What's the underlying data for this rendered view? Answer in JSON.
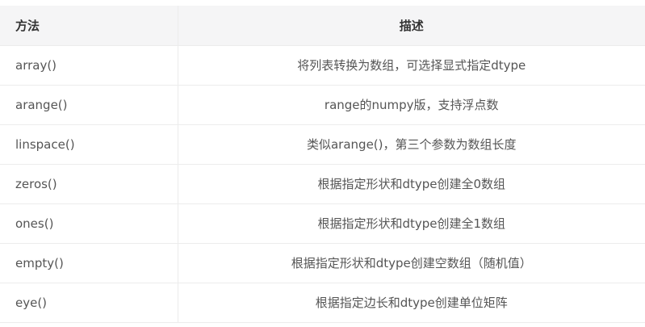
{
  "table": {
    "headers": [
      "方法",
      "描述"
    ],
    "rows": [
      {
        "method": "array()",
        "description": "将列表转换为数组，可选择显式指定dtype"
      },
      {
        "method": "arange()",
        "description": "range的numpy版，支持浮点数"
      },
      {
        "method": "linspace()",
        "description": "类似arange()，第三个参数为数组长度"
      },
      {
        "method": "zeros()",
        "description": "根据指定形状和dtype创建全0数组"
      },
      {
        "method": "ones()",
        "description": "根据指定形状和dtype创建全1数组"
      },
      {
        "method": "empty()",
        "description": "根据指定形状和dtype创建空数组（随机值）"
      },
      {
        "method": "eye()",
        "description": "根据指定边长和dtype创建单位矩阵"
      }
    ]
  }
}
